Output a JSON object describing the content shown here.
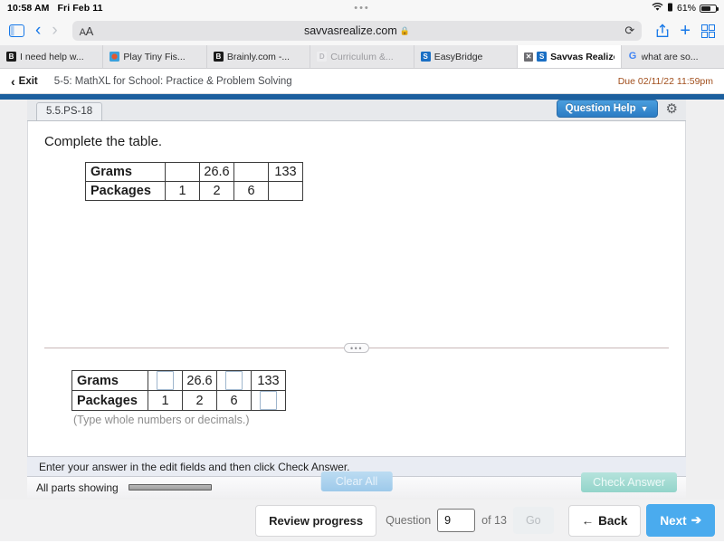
{
  "statusbar": {
    "time": "10:58 AM",
    "date": "Fri Feb 11",
    "center_dots": "•••",
    "battery_pct": "61%"
  },
  "browser": {
    "aa_small": "A",
    "aa_big": "A",
    "url": "savvasrealize.com",
    "lock": "🔒",
    "reload_icon": "⟳",
    "share_icon": "share-icon",
    "newtab_icon": "+",
    "tabs_icon": "tabs-icon",
    "sidebar_icon": "sidebar-icon",
    "back_icon": "‹",
    "forward_icon": "›"
  },
  "tabs": [
    {
      "title": "I need help w...",
      "favicon": "B",
      "active": false
    },
    {
      "title": "Play Tiny Fis...",
      "favicon": "",
      "active": false
    },
    {
      "title": "Brainly.com -...",
      "favicon": "B",
      "active": false
    },
    {
      "title": "Curriculum &...",
      "favicon": "D",
      "active": false
    },
    {
      "title": "EasyBridge",
      "favicon": "S",
      "active": false
    },
    {
      "title": "Savvas Realize",
      "favicon": "S",
      "active": true,
      "close": "✕"
    },
    {
      "title": "what are so...",
      "favicon": "G",
      "active": false
    }
  ],
  "app_header": {
    "exit_label": "Exit",
    "exit_chevron": "‹",
    "assignment_title": "5-5: MathXL for School: Practice & Problem Solving",
    "due": "Due 02/11/22 11:59pm"
  },
  "exercise": {
    "tab_label": "5.5.PS-18",
    "question_help_label": "Question Help",
    "question_help_caret": "▼",
    "gear_icon": "⚙",
    "prompt": "Complete the table.",
    "question_table": {
      "rows": [
        {
          "label": "Grams",
          "cells": [
            "",
            "26.6",
            "",
            "133"
          ]
        },
        {
          "label": "Packages",
          "cells": [
            "1",
            "2",
            "6",
            ""
          ]
        }
      ]
    },
    "divider_handle": "•••",
    "answer_table": {
      "rows": [
        {
          "label": "Grams",
          "cells": [
            "__input__",
            "26.6",
            "__input__",
            "133"
          ]
        },
        {
          "label": "Packages",
          "cells": [
            "1",
            "2",
            "6",
            "__input__"
          ]
        }
      ]
    },
    "hint": "(Type whole numbers or decimals.)",
    "instruction": "Enter your answer in the edit fields and then click Check Answer.",
    "parts_label": "All parts showing",
    "clear_all_label": "Clear All",
    "check_answer_label": "Check Answer"
  },
  "bottom_nav": {
    "review_progress_label": "Review progress",
    "question_word": "Question",
    "question_value": "9",
    "of_label": "of 13",
    "go_label": "Go",
    "back_label": "Back",
    "back_arrow": "←",
    "next_label": "Next",
    "next_arrow": "➔"
  },
  "colors": {
    "accent_blue": "#4aabee",
    "question_help_blue": "#2b7cc4",
    "rail_blue": "#1c5f9e",
    "check_teal": "#93d4ca",
    "due_orange": "#a14f1d"
  }
}
